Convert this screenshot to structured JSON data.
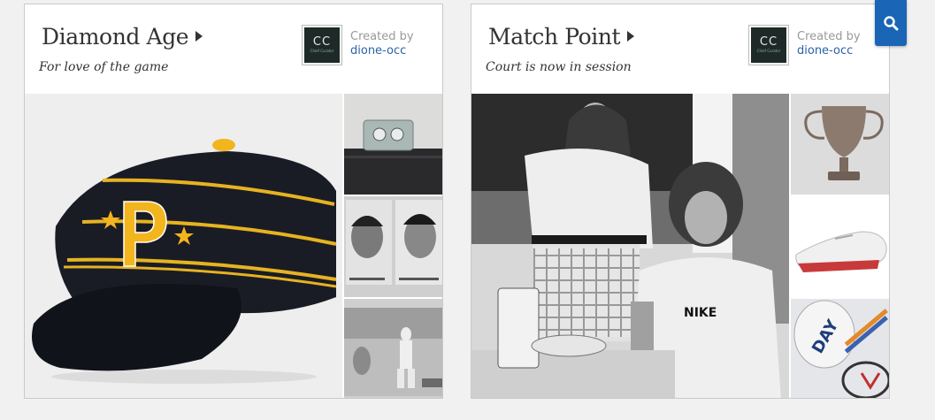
{
  "cards": [
    {
      "title": "Diamond Age",
      "subtitle": "For love of the game",
      "created_by_label": "Created by",
      "author": "dione-occ",
      "avatar": {
        "initials": "CC",
        "caption": "Chief Curator"
      },
      "hero": "pittsburgh-pirates-pillbox-cap-image",
      "thumbs": [
        "vintage-stopwatch-image",
        "yankees-player-cards-image",
        "vintage-baseball-photo-image"
      ]
    },
    {
      "title": "Match Point",
      "subtitle": "Court is now in session",
      "created_by_label": "Created by",
      "author": "dione-occ",
      "avatar": {
        "initials": "CC",
        "caption": "Chief Curator"
      },
      "hero": "tennis-players-photo-image",
      "thumbs": [
        "silver-trophy-cup-image",
        "white-tennis-sneaker-image",
        "tennis-racquet-bag-image"
      ]
    }
  ],
  "search": {
    "icon": "search-icon",
    "color": "#1a65b5"
  }
}
